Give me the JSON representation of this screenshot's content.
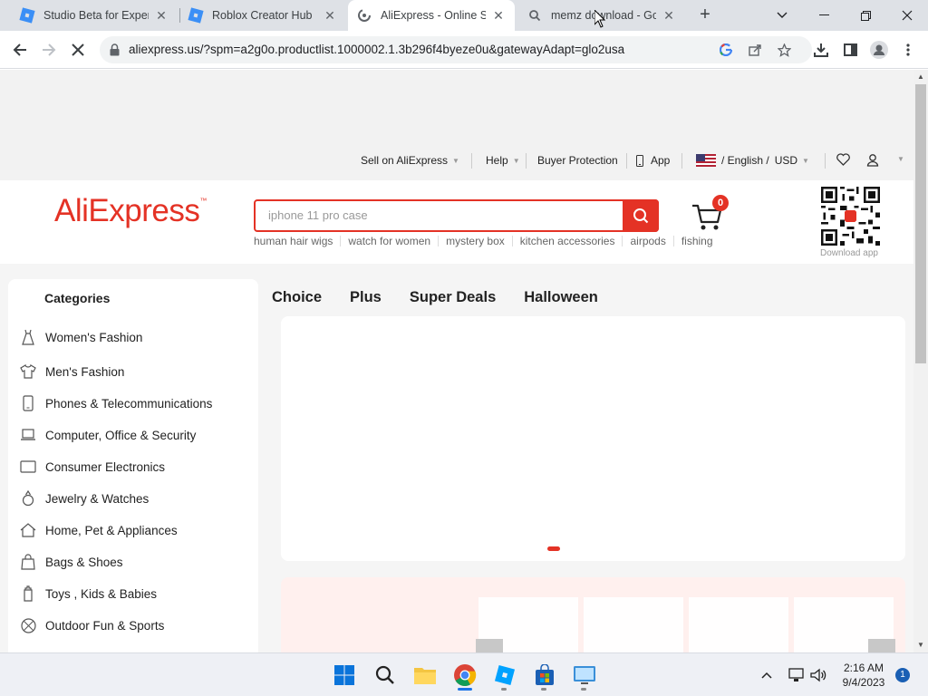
{
  "browser": {
    "tabs": [
      {
        "title": "Studio Beta for Experie",
        "icon": "studio-icon",
        "active": false
      },
      {
        "title": "Roblox Creator Hub",
        "icon": "roblox-icon",
        "active": false
      },
      {
        "title": "AliExpress - Online Sho",
        "icon": "loading-icon",
        "active": true
      },
      {
        "title": "memz download - Goo",
        "icon": "search-icon",
        "active": false
      }
    ],
    "url": "aliexpress.us/?spm=a2g0o.productlist.1000002.1.3b296f4byeze0u&gatewayAdapt=glo2usa"
  },
  "topbar": {
    "sell": "Sell on AliExpress",
    "help": "Help",
    "buyer_protection": "Buyer Protection",
    "app": "App",
    "language": "/ English /",
    "currency": "USD"
  },
  "header": {
    "logo": "AliExpress",
    "search_placeholder": "iphone 11 pro case",
    "hotwords": [
      "human hair wigs",
      "watch for women",
      "mystery box",
      "kitchen accessories",
      "airpods",
      "fishing"
    ],
    "cart_count": "0",
    "download_app": "Download app"
  },
  "categories": {
    "title": "Categories",
    "items": [
      {
        "label": "Women's Fashion",
        "icon": "dress-icon"
      },
      {
        "label": "Men's Fashion",
        "icon": "shirt-icon"
      },
      {
        "label": "Phones & Telecommunications",
        "icon": "phone-icon"
      },
      {
        "label": "Computer, Office & Security",
        "icon": "laptop-icon"
      },
      {
        "label": "Consumer Electronics",
        "icon": "tv-icon"
      },
      {
        "label": "Jewelry & Watches",
        "icon": "ring-icon"
      },
      {
        "label": "Home, Pet & Appliances",
        "icon": "home-icon"
      },
      {
        "label": "Bags & Shoes",
        "icon": "bag-icon"
      },
      {
        "label": "Toys , Kids & Babies",
        "icon": "baby-bottle-icon"
      },
      {
        "label": "Outdoor Fun & Sports",
        "icon": "ball-icon"
      }
    ]
  },
  "navtabs": [
    "Choice",
    "Plus",
    "Super Deals",
    "Halloween"
  ],
  "taskbar": {
    "time": "2:16 AM",
    "date": "9/4/2023",
    "notifications": "1"
  },
  "colors": {
    "brand": "#e43225",
    "tab_strip": "#dee1e6"
  }
}
